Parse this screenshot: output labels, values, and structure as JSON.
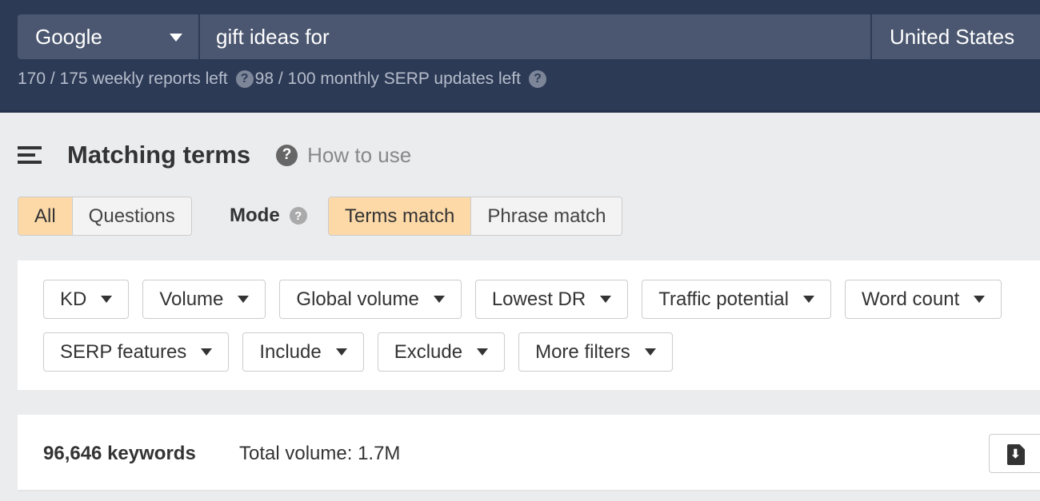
{
  "search": {
    "engine": "Google",
    "query": "gift ideas for",
    "country": "United States",
    "weekly_reports": "170 / 175 weekly reports left",
    "monthly_updates": "98 / 100 monthly SERP updates left"
  },
  "page": {
    "title": "Matching terms",
    "how_to_use": "How to use"
  },
  "tabs": {
    "all": "All",
    "questions": "Questions",
    "active": "All"
  },
  "mode": {
    "label": "Mode",
    "terms": "Terms match",
    "phrase": "Phrase match",
    "active": "Terms match"
  },
  "filters": {
    "row1": [
      "KD",
      "Volume",
      "Global volume",
      "Lowest DR",
      "Traffic potential",
      "Word count"
    ],
    "row2": [
      "SERP features",
      "Include",
      "Exclude",
      "More filters"
    ]
  },
  "results": {
    "count": "96,646 keywords",
    "total_volume": "Total volume: 1.7M"
  },
  "colors": {
    "header": "#2d3a55",
    "active_tab": "#fdd9a8"
  }
}
